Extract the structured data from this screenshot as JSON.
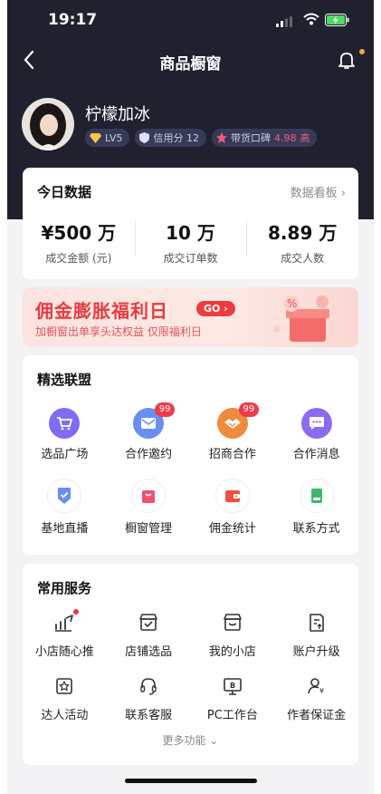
{
  "status": {
    "time": "19:17"
  },
  "nav": {
    "title": "商品橱窗"
  },
  "user": {
    "name": "柠檬加冰",
    "level": "LV5",
    "credit": "信用分 12",
    "reputation_label": "带货口碑",
    "reputation_score": "4.98",
    "reputation_level": "高"
  },
  "today": {
    "title": "今日数据",
    "link": "数据看板",
    "stats": [
      {
        "value": "¥500 万",
        "label": "成交金额 (元)"
      },
      {
        "value": "10 万",
        "label": "成交订单数"
      },
      {
        "value": "8.89 万",
        "label": "成交人数"
      }
    ]
  },
  "banner": {
    "title": "佣金膨胀福利日",
    "go": "GO",
    "subtitle": "加橱窗出单享头达权益 仅限福利日"
  },
  "alliance": {
    "title": "精选联盟",
    "items": [
      {
        "label": "选品广场",
        "icon": "cart-icon"
      },
      {
        "label": "合作邀约",
        "icon": "mail-icon",
        "badge": "99"
      },
      {
        "label": "招商合作",
        "icon": "handshake-icon",
        "badge": "99"
      },
      {
        "label": "合作消息",
        "icon": "message-icon"
      },
      {
        "label": "基地直播",
        "icon": "shield-check-icon"
      },
      {
        "label": "橱窗管理",
        "icon": "shopping-bag-icon"
      },
      {
        "label": "佣金统计",
        "icon": "wallet-icon"
      },
      {
        "label": "联系方式",
        "icon": "phone-icon"
      }
    ]
  },
  "services": {
    "title": "常用服务",
    "more": "更多功能",
    "items": [
      {
        "label": "小店随心推",
        "icon": "boost-icon"
      },
      {
        "label": "店铺选品",
        "icon": "store-select-icon"
      },
      {
        "label": "我的小店",
        "icon": "shop-icon"
      },
      {
        "label": "账户升级",
        "icon": "upgrade-icon"
      },
      {
        "label": "达人活动",
        "icon": "star-box-icon"
      },
      {
        "label": "联系客服",
        "icon": "headset-icon"
      },
      {
        "label": "PC工作台",
        "icon": "monitor-icon"
      },
      {
        "label": "作者保证金",
        "icon": "deposit-icon"
      }
    ]
  },
  "colors": {
    "header_bg": "#20212f",
    "accent_red": "#ee3b3f",
    "alliance_purple": "#7c6df2",
    "alliance_blue": "#6a8ff0",
    "alliance_orange": "#f08a3c"
  }
}
